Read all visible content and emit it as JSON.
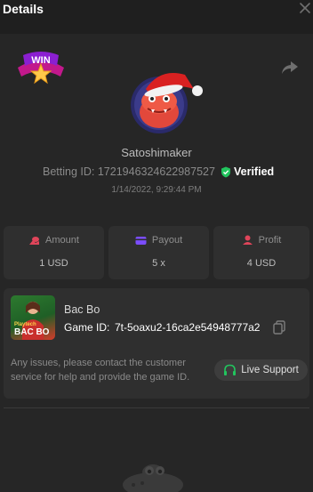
{
  "header": {
    "title": "Details",
    "close_icon": "close-icon"
  },
  "badge": {
    "text": "WIN"
  },
  "user": {
    "name": "Satoshimaker",
    "betting_label": "Betting ID:",
    "betting_id": "1721946324622987527",
    "verified_label": "Verified",
    "timestamp": "1/14/2022, 9:29:44 PM"
  },
  "stats": [
    {
      "icon": "coins-icon",
      "label": "Amount",
      "value": "1 USD"
    },
    {
      "icon": "wallet-icon",
      "label": "Payout",
      "value": "5 x"
    },
    {
      "icon": "profit-icon",
      "label": "Profit",
      "value": "4 USD"
    }
  ],
  "game": {
    "thumb_small": "Playtech",
    "thumb_title": "BAC BO",
    "name": "Bac Bo",
    "id_label": "Game ID:",
    "id_value": "7t-5oaxu2-16ca2e54948777a2",
    "notice": "Any issues, please contact the customer service for help and provide the game ID.",
    "support_label": "Live Support"
  },
  "colors": {
    "background": "#262626",
    "card": "#2f2f2f",
    "verified_green": "#22c55e",
    "accent_red": "#e0455a",
    "accent_purple": "#7b4dff"
  }
}
